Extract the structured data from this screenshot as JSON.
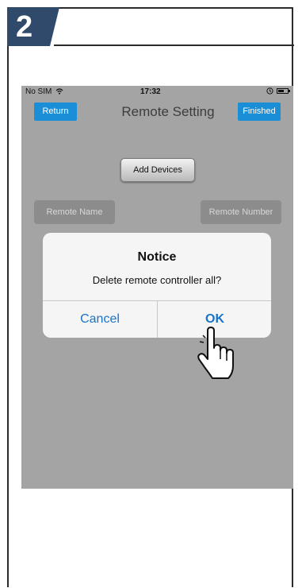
{
  "step": {
    "number": "2"
  },
  "status_bar": {
    "carrier": "No SIM",
    "time": "17:32"
  },
  "nav": {
    "return_label": "Return",
    "title": "Remote Setting",
    "finished_label": "Finished"
  },
  "main": {
    "add_devices_label": "Add Devices",
    "remote_name_label": "Remote Name",
    "remote_number_label": "Remote Number"
  },
  "dialog": {
    "title": "Notice",
    "message": "Delete remote controller all?",
    "cancel_label": "Cancel",
    "ok_label": "OK"
  },
  "colors": {
    "accent_blue": "#1a8fd8",
    "dialog_button_text": "#1a73c9",
    "screen_gray": "#a4a4a4",
    "badge": "#2f4a6b"
  },
  "icons": [
    "wifi-icon",
    "alarm-icon",
    "battery-icon",
    "pointing-hand-icon"
  ]
}
